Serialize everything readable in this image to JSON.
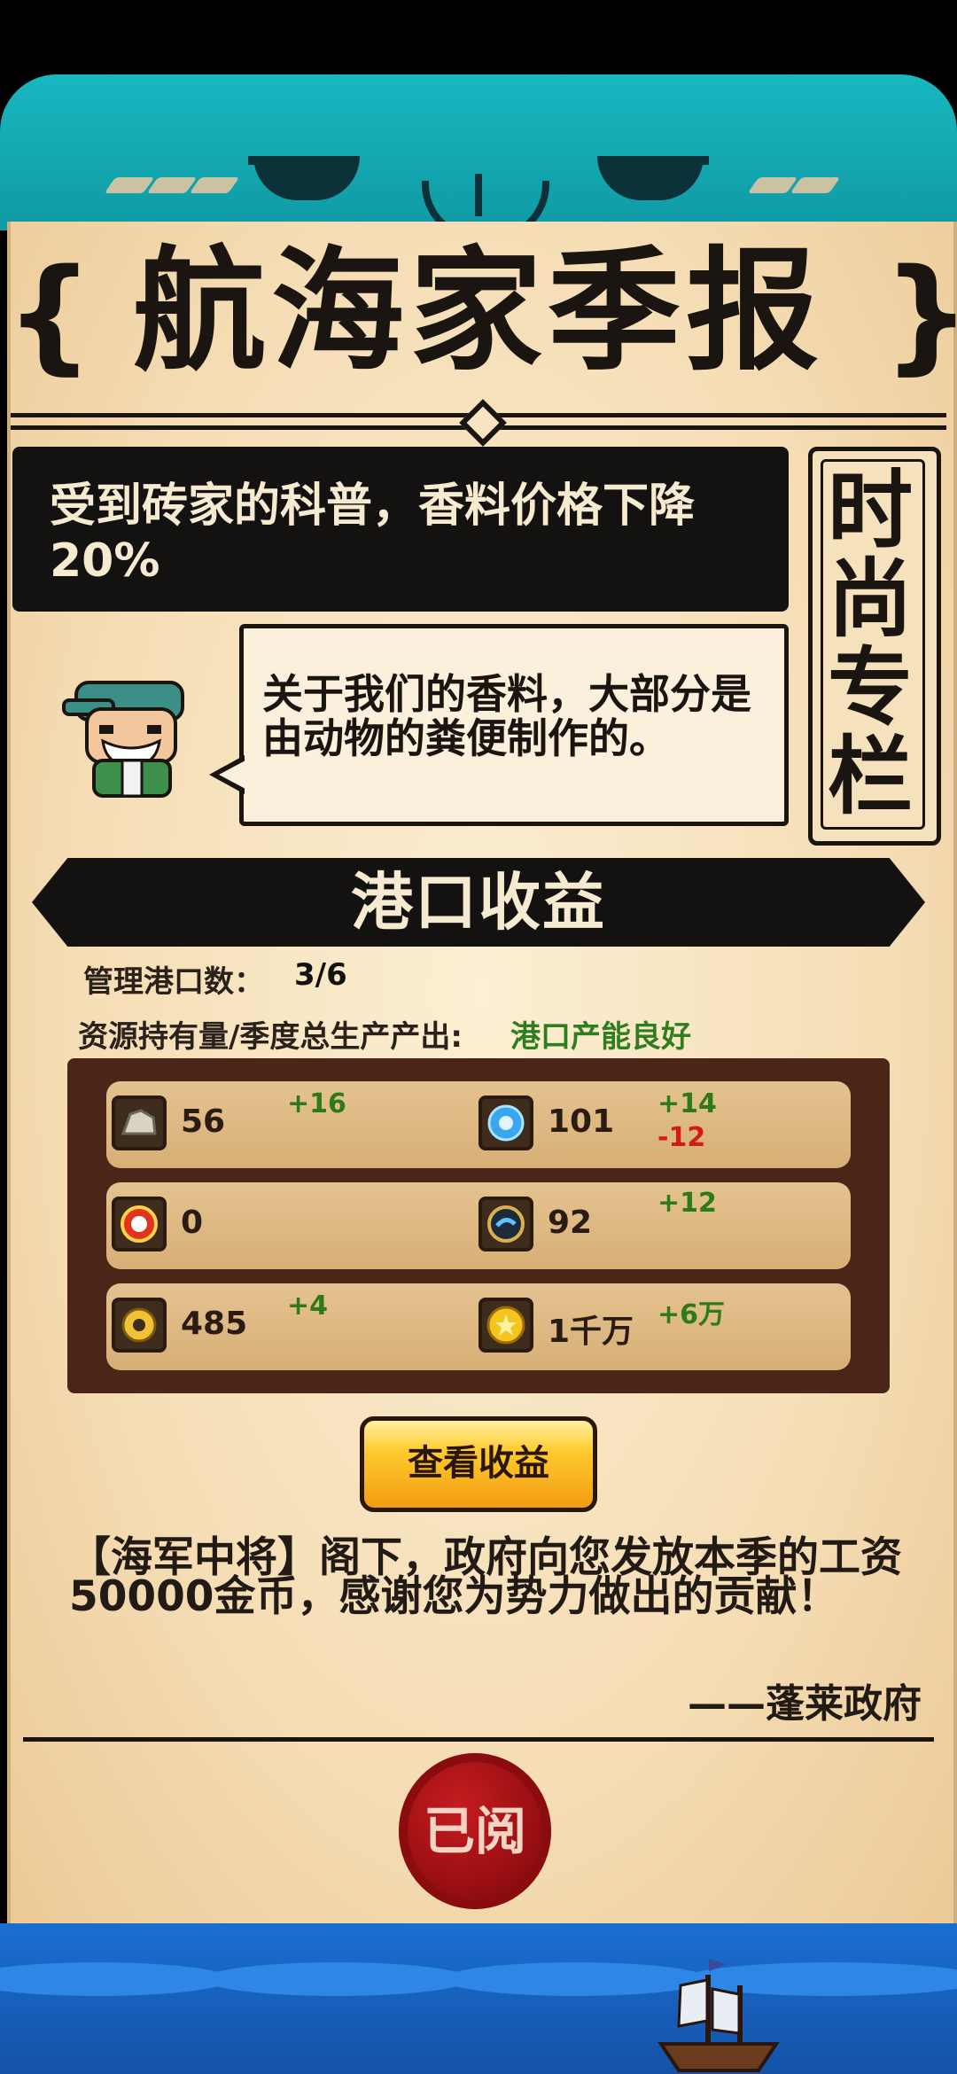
{
  "title": "航海家季报",
  "brackets": {
    "left": "{",
    "right": "}"
  },
  "headline": "受到砖家的科普，香料价格下降20%",
  "column_label": "时尚专栏",
  "speech": "关于我们的香料，大部分是由动物的粪便制作的。",
  "section_title": "港口收益",
  "managed_ports_label": "管理港口数：",
  "managed_ports_value": "3/6",
  "resource_label": "资源持有量/季度总生产产出:",
  "resource_status": "港口产能良好",
  "resources": [
    {
      "icon": "stone-icon",
      "value": "56",
      "up": "+16",
      "down": ""
    },
    {
      "icon": "crystal-orb-icon",
      "value": "101",
      "up": "+14",
      "down": "-12"
    },
    {
      "icon": "gear-badge-icon",
      "value": "0",
      "up": "",
      "down": ""
    },
    {
      "icon": "blue-seal-icon",
      "value": "92",
      "up": "+12",
      "down": ""
    },
    {
      "icon": "cog-icon",
      "value": "485",
      "up": "+4",
      "down": ""
    },
    {
      "icon": "gold-coin-icon",
      "value": "1千万",
      "up": "+6万",
      "down": ""
    }
  ],
  "view_button": "查看收益",
  "notice": "【海军中将】阁下，政府向您发放本季的工资50000金币，感谢您为势力做出的贡献！",
  "signature": "——蓬莱政府",
  "seal_label": "已阅",
  "colors": {
    "teal": "#19b7c0",
    "parchment": "#f5ddb5",
    "panel": "#4a2518",
    "gain": "#2d7a18",
    "loss": "#d11b14",
    "seal": "#9b0f12"
  }
}
